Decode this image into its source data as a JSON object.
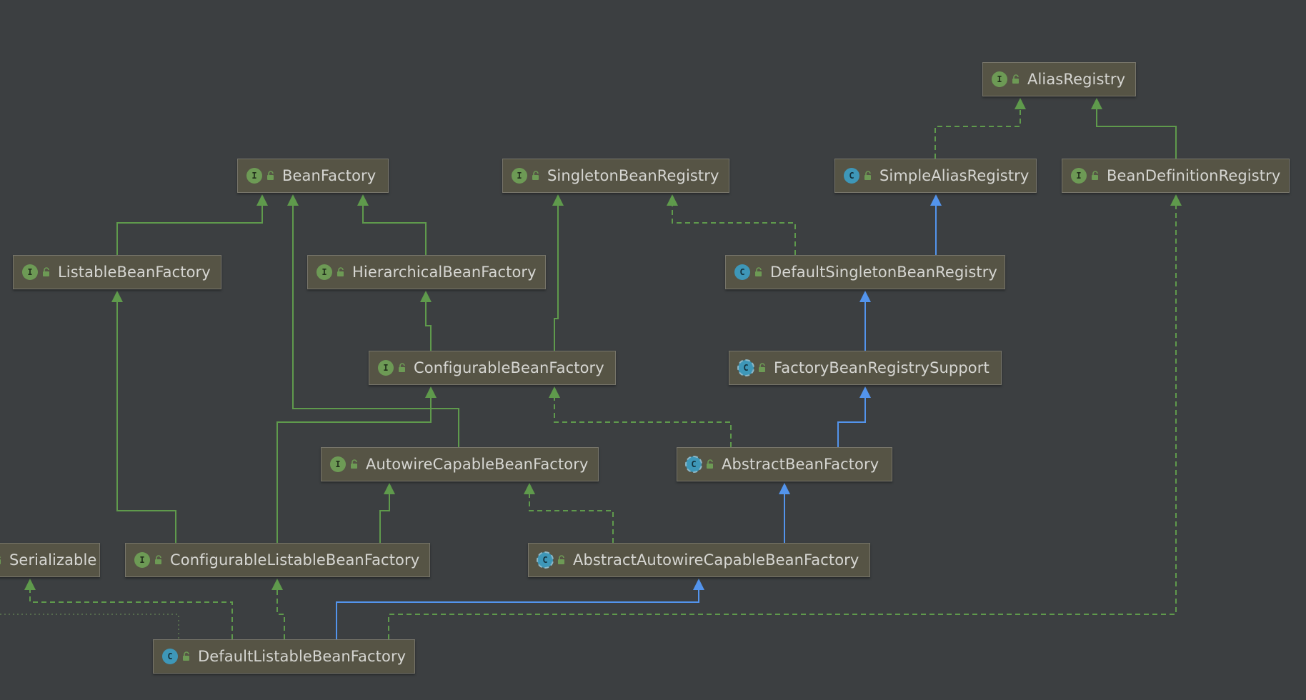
{
  "nodes": {
    "alias_registry": {
      "name": "AliasRegistry",
      "kind": "interface",
      "badge": "I"
    },
    "bean_factory": {
      "name": "BeanFactory",
      "kind": "interface",
      "badge": "I"
    },
    "singleton_bean_registry": {
      "name": "SingletonBeanRegistry",
      "kind": "interface",
      "badge": "I"
    },
    "simple_alias_registry": {
      "name": "SimpleAliasRegistry",
      "kind": "class",
      "badge": "C"
    },
    "bean_definition_registry": {
      "name": "BeanDefinitionRegistry",
      "kind": "interface",
      "badge": "I"
    },
    "listable_bean_factory": {
      "name": "ListableBeanFactory",
      "kind": "interface",
      "badge": "I"
    },
    "hierarchical_bean_factory": {
      "name": "HierarchicalBeanFactory",
      "kind": "interface",
      "badge": "I"
    },
    "default_singleton_bean_registry": {
      "name": "DefaultSingletonBeanRegistry",
      "kind": "class",
      "badge": "C"
    },
    "configurable_bean_factory": {
      "name": "ConfigurableBeanFactory",
      "kind": "interface",
      "badge": "I"
    },
    "factory_bean_registry_support": {
      "name": "FactoryBeanRegistrySupport",
      "kind": "abstract",
      "badge": "C"
    },
    "autowire_capable_bean_factory": {
      "name": "AutowireCapableBeanFactory",
      "kind": "interface",
      "badge": "I"
    },
    "abstract_bean_factory": {
      "name": "AbstractBeanFactory",
      "kind": "abstract",
      "badge": "C"
    },
    "serializable": {
      "name": "Serializable",
      "kind": "interface",
      "badge": "I"
    },
    "configurable_listable_bean_factory": {
      "name": "ConfigurableListableBeanFactory",
      "kind": "interface",
      "badge": "I"
    },
    "abstract_autowire_capable_bean_factory": {
      "name": "AbstractAutowireCapableBeanFactory",
      "kind": "abstract",
      "badge": "C"
    },
    "default_listable_bean_factory": {
      "name": "DefaultListableBeanFactory",
      "kind": "class",
      "badge": "C"
    }
  },
  "colors": {
    "background": "#3c3f41",
    "node_fill": "#565445",
    "node_border": "#77756a",
    "interface_edge": "#5f9a4c",
    "extends_edge": "#5394ec",
    "implements_edge": "#5f9a4c",
    "interface_badge": "#6d9a55",
    "class_badge": "#3e97b8",
    "label_text": "#d6d6d2"
  },
  "edges": [
    {
      "from": "simple_alias_registry",
      "to": "alias_registry",
      "type": "implements"
    },
    {
      "from": "bean_definition_registry",
      "to": "alias_registry",
      "type": "extends-interface"
    },
    {
      "from": "listable_bean_factory",
      "to": "bean_factory",
      "type": "extends-interface"
    },
    {
      "from": "hierarchical_bean_factory",
      "to": "bean_factory",
      "type": "extends-interface"
    },
    {
      "from": "autowire_capable_bean_factory",
      "to": "bean_factory",
      "type": "extends-interface"
    },
    {
      "from": "default_singleton_bean_registry",
      "to": "singleton_bean_registry",
      "type": "implements"
    },
    {
      "from": "default_singleton_bean_registry",
      "to": "simple_alias_registry",
      "type": "extends"
    },
    {
      "from": "configurable_bean_factory",
      "to": "hierarchical_bean_factory",
      "type": "extends-interface"
    },
    {
      "from": "configurable_bean_factory",
      "to": "singleton_bean_registry",
      "type": "extends-interface"
    },
    {
      "from": "factory_bean_registry_support",
      "to": "default_singleton_bean_registry",
      "type": "extends"
    },
    {
      "from": "abstract_bean_factory",
      "to": "factory_bean_registry_support",
      "type": "extends"
    },
    {
      "from": "abstract_bean_factory",
      "to": "configurable_bean_factory",
      "type": "implements"
    },
    {
      "from": "configurable_listable_bean_factory",
      "to": "listable_bean_factory",
      "type": "extends-interface"
    },
    {
      "from": "configurable_listable_bean_factory",
      "to": "autowire_capable_bean_factory",
      "type": "extends-interface"
    },
    {
      "from": "configurable_listable_bean_factory",
      "to": "configurable_bean_factory",
      "type": "extends-interface"
    },
    {
      "from": "abstract_autowire_capable_bean_factory",
      "to": "abstract_bean_factory",
      "type": "extends"
    },
    {
      "from": "abstract_autowire_capable_bean_factory",
      "to": "autowire_capable_bean_factory",
      "type": "implements"
    },
    {
      "from": "default_listable_bean_factory",
      "to": "abstract_autowire_capable_bean_factory",
      "type": "extends"
    },
    {
      "from": "default_listable_bean_factory",
      "to": "configurable_listable_bean_factory",
      "type": "implements"
    },
    {
      "from": "default_listable_bean_factory",
      "to": "serializable",
      "type": "implements"
    },
    {
      "from": "default_listable_bean_factory",
      "to": "bean_definition_registry",
      "type": "implements"
    }
  ]
}
